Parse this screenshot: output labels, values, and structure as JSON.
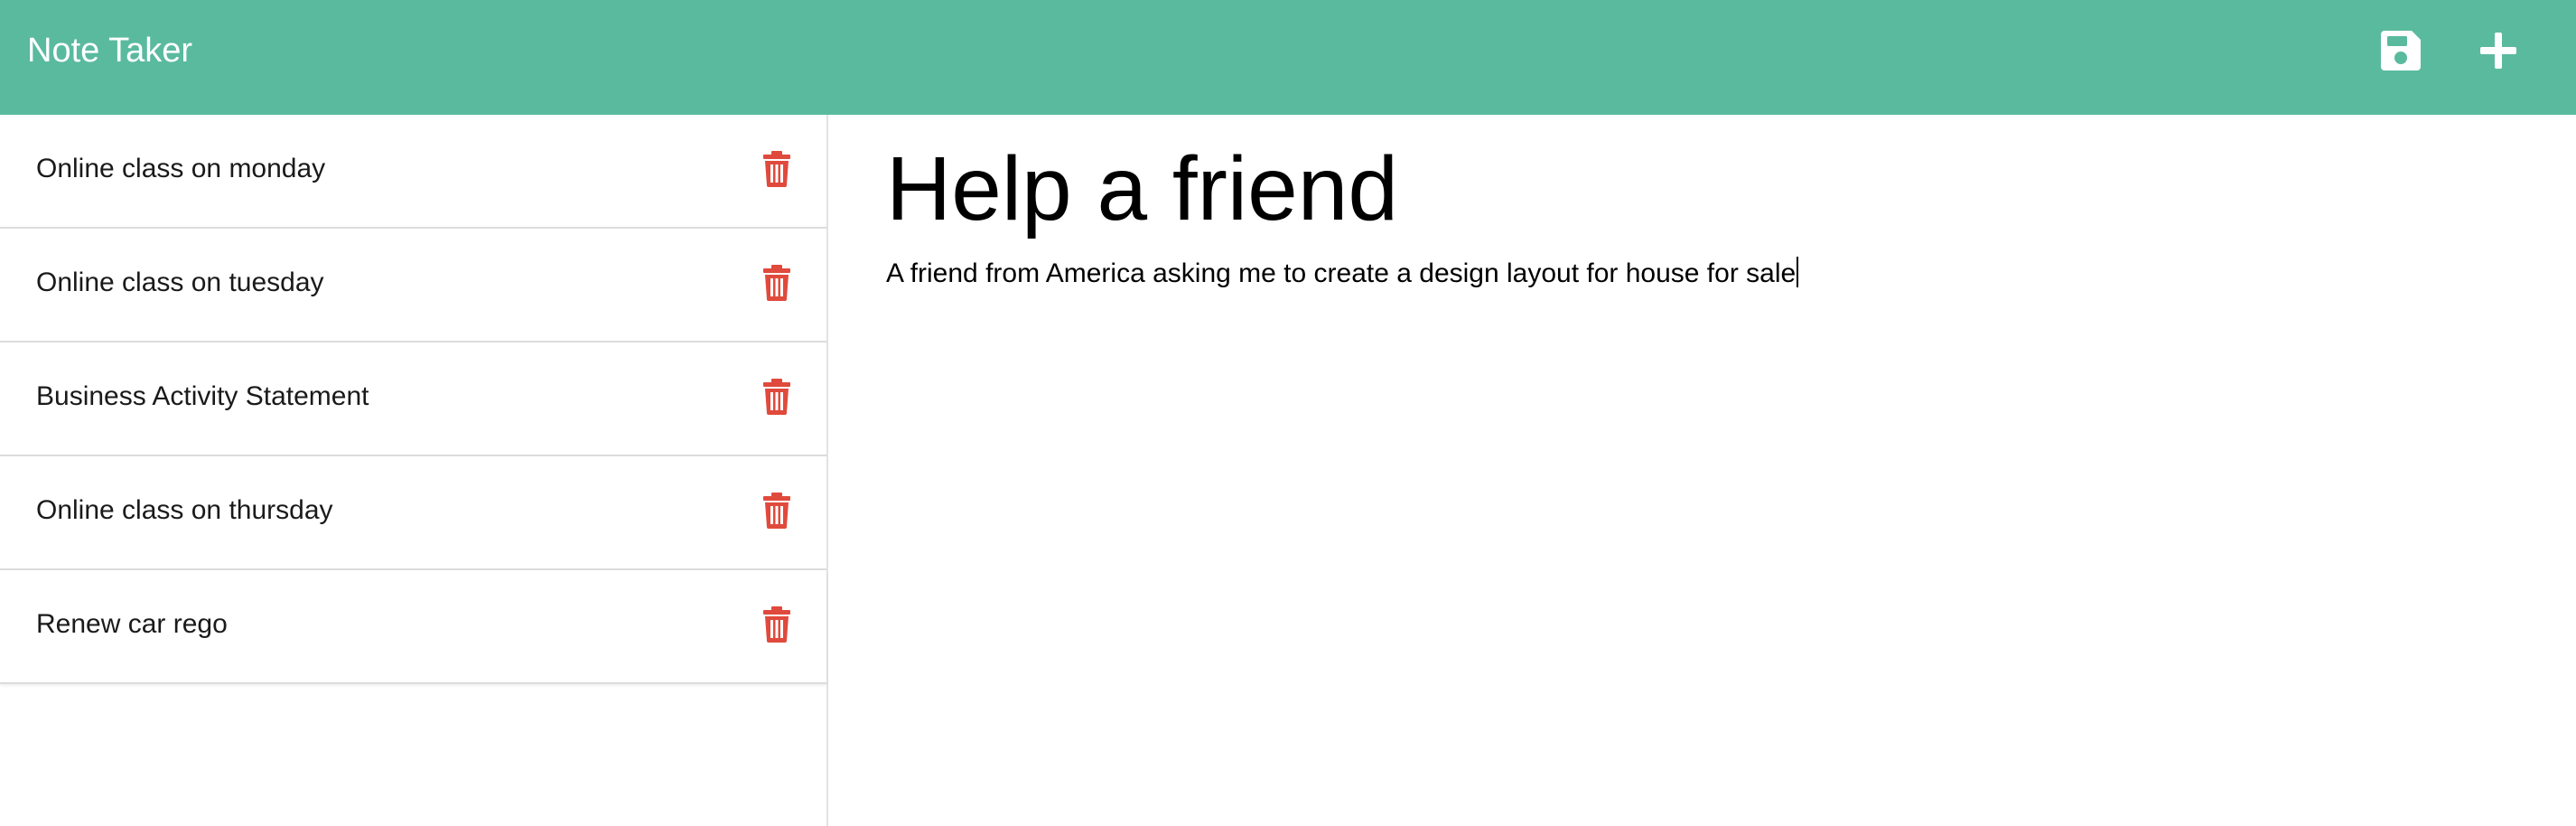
{
  "app": {
    "title": "Note Taker"
  },
  "toolbar": {
    "save_icon": "floppy-disk-icon",
    "new_icon": "plus-icon"
  },
  "colors": {
    "navbar": "#5aba9e",
    "delete": "#e04a3c",
    "icon": "#ffffff"
  },
  "notes": [
    {
      "title": "Online class on monday"
    },
    {
      "title": "Online class on tuesday"
    },
    {
      "title": "Business Activity Statement"
    },
    {
      "title": "Online class on thursday"
    },
    {
      "title": "Renew car rego"
    }
  ],
  "active_note": {
    "title": "Help a friend",
    "text": "A friend from America asking me to create a design layout for house for sale"
  }
}
